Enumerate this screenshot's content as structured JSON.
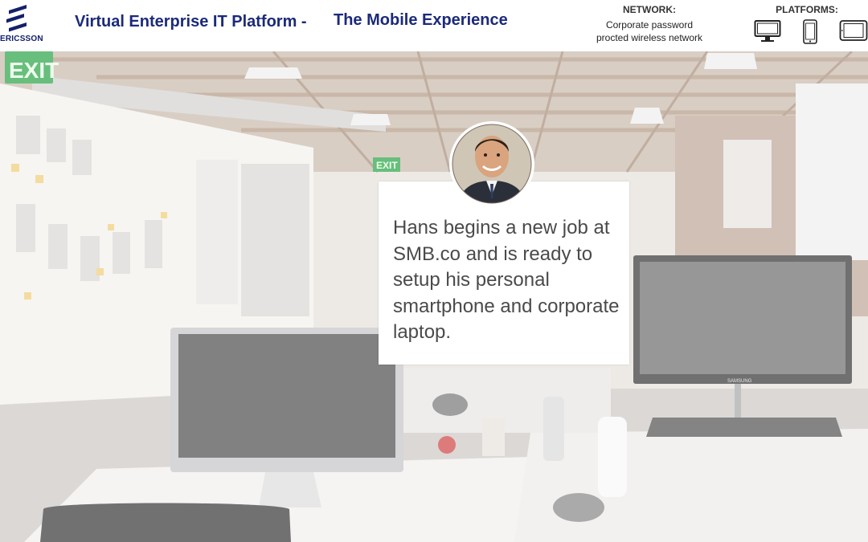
{
  "header": {
    "brand": "ERICSSON",
    "title": "Virtual Enterprise IT Platform -",
    "subtitle": "The Mobile Experience",
    "network": {
      "label": "NETWORK:",
      "line1": "Corporate password",
      "line2": "procted wireless network"
    },
    "platforms": {
      "label": "PLATFORMS:",
      "items": [
        "desktop-monitor-icon",
        "smartphone-icon",
        "tablet-icon"
      ]
    }
  },
  "scene": {
    "exit_sign": "EXIT",
    "exit_sign_2": "EXIT",
    "monitor_brand": "SAMSUNG"
  },
  "story": {
    "text": "Hans begins a new job at SMB.co and is ready to setup his personal smartphone and corporate laptop."
  },
  "colors": {
    "brand_navy": "#1b2a7a",
    "exit_green": "#2fa64a"
  }
}
